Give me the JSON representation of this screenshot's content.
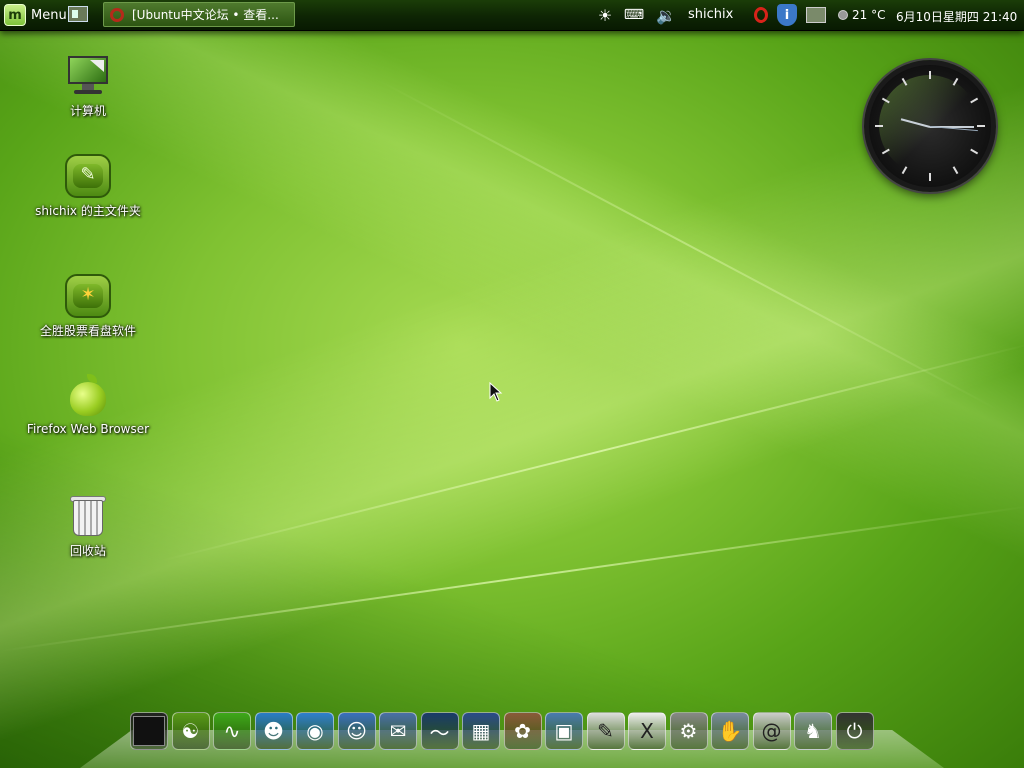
{
  "top_panel": {
    "menu_label": "Menu",
    "menu_logo_glyph": "m",
    "window_button_title": "[Ubuntu中文论坛 • 查看...",
    "username": "shichix",
    "temperature": "21 °C",
    "datetime": "6月10日星期四 21:40",
    "tray_icons": [
      "brightness-icon",
      "network-icon",
      "volume-icon",
      "opera-icon",
      "info-icon",
      "network-monitor-icon"
    ]
  },
  "desktop_icons": [
    {
      "label": "计算机",
      "icon": "computer-icon"
    },
    {
      "label": "shichix 的主文件夹",
      "icon": "home-folder-icon"
    },
    {
      "label": "全胜股票看盘软件",
      "icon": "stock-app-icon"
    },
    {
      "label": "Firefox Web Browser",
      "icon": "apple-firefox-icon"
    },
    {
      "label": "回收站",
      "icon": "trash-icon"
    }
  ],
  "dock_items": [
    {
      "name": "terminal-icon",
      "color": "#222222"
    },
    {
      "name": "opensuse-icon",
      "color": "#5a9a1a"
    },
    {
      "name": "worm-icon",
      "color": "#3ea81a"
    },
    {
      "name": "messenger-icon",
      "color": "#2a7cc8"
    },
    {
      "name": "globe-icon",
      "color": "#2f7fd0"
    },
    {
      "name": "finder-icon",
      "color": "#3a6fc0"
    },
    {
      "name": "mail-stamp-icon",
      "color": "#4a6fa8"
    },
    {
      "name": "activity-monitor-icon",
      "color": "#1a3a6a"
    },
    {
      "name": "clapper-icon",
      "color": "#2a4a8a"
    },
    {
      "name": "photo-icon",
      "color": "#8a5a3a"
    },
    {
      "name": "network-icon",
      "color": "#4a7ab0"
    },
    {
      "name": "text-editor-icon",
      "color": "#dddddd"
    },
    {
      "name": "x11-icon",
      "color": "#eeeeee"
    },
    {
      "name": "system-preferences-icon",
      "color": "#888888"
    },
    {
      "name": "robot-arm-icon",
      "color": "#7a8aa0"
    },
    {
      "name": "mail-at-icon",
      "color": "#cccccc"
    },
    {
      "name": "elephant-icon",
      "color": "#8a9aa0"
    },
    {
      "name": "power-icon",
      "color": "#333333"
    }
  ],
  "dock_glyphs": {
    "opensuse-icon": "☯",
    "worm-icon": "∿",
    "messenger-icon": "☻",
    "globe-icon": "◉",
    "finder-icon": "☺",
    "mail-stamp-icon": "✉",
    "activity-monitor-icon": "〜",
    "clapper-icon": "▦",
    "photo-icon": "✿",
    "network-icon": "▣",
    "text-editor-icon": "✎",
    "x11-icon": "X",
    "system-preferences-icon": "⚙",
    "robot-arm-icon": "✋",
    "mail-at-icon": "@",
    "elephant-icon": "♞",
    "power-icon": "⏻"
  },
  "colors": {
    "panel_bg": "#0e2504",
    "desktop_green": "#80c232",
    "accent_light": "#c9f08a"
  }
}
